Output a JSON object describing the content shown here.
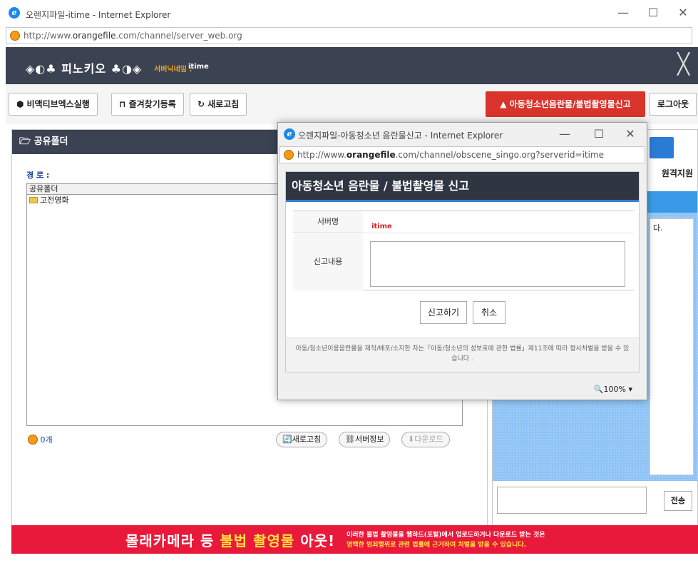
{
  "main_window": {
    "title": "오렌지파일-itime - Internet Explorer",
    "url_prefix": "http://www.",
    "url_domain": "orangefile",
    "url_suffix": ".com/channel/server_web.org",
    "min_icon": "—",
    "max_icon": "☐",
    "close_icon": "✕"
  },
  "topbar": {
    "brand": "◈◐♣ 피노키오 ♣◑◈",
    "server_label": "서버닉네임 :",
    "server_name": "itime",
    "close_icon": "╳"
  },
  "toolbar": {
    "activex_label": "비액티브엑스실행",
    "bookmark_label": "즐겨찾기등록",
    "refresh_label": "새로고침",
    "report_label": "▲ 아동청소년음란물/불법촬영물신고",
    "logout_label": "로그아웃"
  },
  "shared_folder": {
    "header": "공유폴더",
    "path_label": "경 로 :",
    "column_header": "공유폴더",
    "items": [
      {
        "name": "고전영화"
      }
    ],
    "count": "0개",
    "refresh_button": "새로고침",
    "server_info_button": "서버정보",
    "download_button": "다운로드"
  },
  "right_panel": {
    "remote_label": "원격지원",
    "chat_text": "다.",
    "send_button": "전송"
  },
  "banner": {
    "title_part1": "몰래카메라 등 ",
    "title_part2": "불법 촬영물",
    "title_part3": " 아웃!",
    "text_line1": "이러한 불법 촬영물을 웹하드(포털)에서 업로드하거나 다운로드 받는 것은",
    "text_line2": "명백한 범죄행위로 관련 법률에 근거하여 처벌을 받을 수 있습니다."
  },
  "popup": {
    "title": "오렌지파일-아동청소년 음란물신고 - Internet Explorer",
    "url_prefix": "http://www.",
    "url_domain": "orangefile",
    "url_suffix": ".com/channel/obscene_singo.org?serverid=itime",
    "header": "아동청소년 음란물 / 불법촬영물 신고",
    "server_label": "서버명",
    "server_value": "itime",
    "content_label": "신고내용",
    "content_value": "",
    "submit_button": "신고하기",
    "cancel_button": "취소",
    "notice": "아동/청소년이용음란물을 제작/배포/소지한 자는「아동/청소년의 성보호에 관한 법률」제11조에 따라 형사처벌을 받을 수 있습니다 .",
    "zoom": "🔍100%  ▾"
  },
  "colors": {
    "header_dark": "#3b4252",
    "report_red": "#d9342b",
    "banner_red": "#e8193a",
    "chat_blue": "#8ec3f5"
  }
}
